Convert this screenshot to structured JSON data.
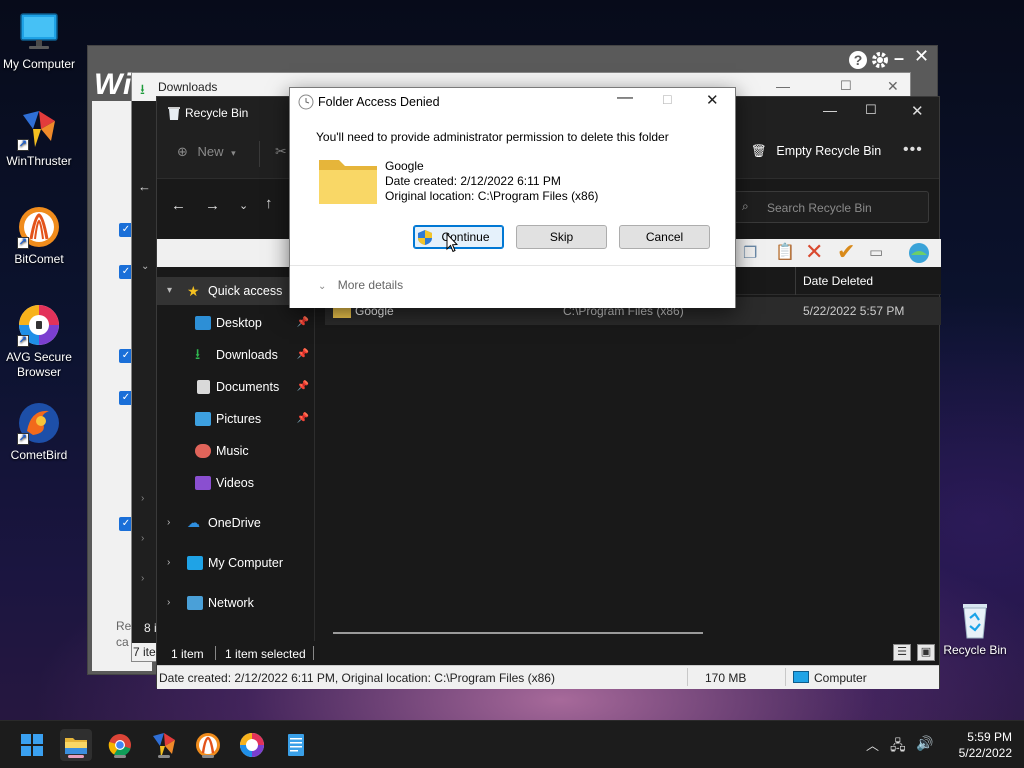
{
  "desktop": {
    "icons": [
      {
        "label": "My Computer",
        "icon": "monitor-icon"
      },
      {
        "label": "WinThruster",
        "icon": "winthruster-icon"
      },
      {
        "label": "BitComet",
        "icon": "bitcomet-icon"
      },
      {
        "label": "AVG Secure Browser",
        "icon": "avg-browser-icon"
      },
      {
        "label": "CometBird",
        "icon": "cometbird-icon"
      }
    ],
    "recycle_bin_label": "Recycle Bin"
  },
  "winthruster": {
    "brand": "Wi",
    "left_texts": [
      "Re",
      "ca"
    ]
  },
  "downloads_window": {
    "title": "Downloads",
    "status_count": "7 ite",
    "side_count": "8 i"
  },
  "recycle_window": {
    "title": "Recycle Bin",
    "new_label": "New",
    "empty_label": "Empty Recycle Bin",
    "search_placeholder": "Search Recycle Bin",
    "columns": {
      "date_deleted": "Date Deleted"
    },
    "row": {
      "name": "Google",
      "location": "C:\\Program Files (x86)",
      "date_deleted": "5/22/2022 5:57 PM"
    },
    "nav": {
      "quick_access": "Quick access",
      "desktop": "Desktop",
      "downloads": "Downloads",
      "documents": "Documents",
      "pictures": "Pictures",
      "music": "Music",
      "videos": "Videos",
      "onedrive": "OneDrive",
      "my_computer": "My Computer",
      "network": "Network"
    },
    "status": {
      "items": "1 item",
      "selected": "1 item selected"
    },
    "bottom": {
      "info": "Date created: 2/12/2022 6:11 PM, Original location: C:\\Program Files (x86)",
      "size": "170 MB",
      "computer": "Computer"
    }
  },
  "dialog": {
    "title": "Folder Access Denied",
    "message": "You'll need to provide administrator permission to delete this folder",
    "folder_name": "Google",
    "date_created": "Date created: 2/12/2022 6:11 PM",
    "original_location": "Original location: C:\\Program Files (x86)",
    "continue_label": "Continue",
    "skip_label": "Skip",
    "cancel_label": "Cancel",
    "more_details": "More details"
  },
  "taskbar": {
    "apps": [
      "start-icon",
      "file-explorer-icon",
      "chrome-icon",
      "winthruster-icon",
      "bitcomet-icon",
      "avg-browser-icon",
      "notepad-icon"
    ],
    "time": "5:59 PM",
    "date": "5/22/2022"
  },
  "colors": {
    "accent": "#0078d4",
    "folder": "#f3c94e",
    "explorer_bg": "#191919",
    "taskbar_bg": "#1c1c1c"
  }
}
